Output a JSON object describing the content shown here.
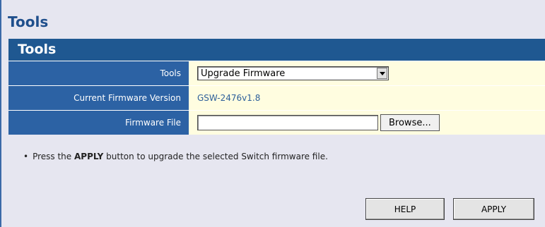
{
  "page": {
    "title": "Tools"
  },
  "panel": {
    "header": "Tools",
    "rows": [
      {
        "label": "Tools",
        "select_value": "Upgrade Firmware"
      },
      {
        "label": "Current Firmware Version",
        "value": "GSW-2476v1.8"
      },
      {
        "label": "Firmware File",
        "file_value": "",
        "browse_label": "Browse..."
      }
    ]
  },
  "note": {
    "bullet": "•",
    "prefix": "Press the ",
    "emphasis": "APPLY",
    "suffix": " button to upgrade the selected Switch firmware file."
  },
  "buttons": {
    "help": "HELP",
    "apply": "APPLY"
  },
  "colors": {
    "header_bg": "#1f5891",
    "label_bg": "#2c62a4",
    "value_bg": "#fffde0",
    "title_text": "#1f4f8c"
  },
  "icons": {
    "dropdown": "chevron-down-icon"
  }
}
